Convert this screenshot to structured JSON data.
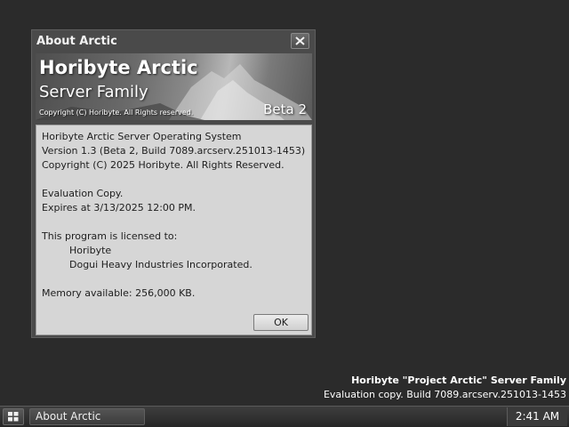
{
  "dialog": {
    "title": "About Arctic",
    "close_icon": "close-icon",
    "banner": {
      "product": "Horibyte Arctic",
      "subtitle": "Server Family",
      "copyright": "Copyright (C) Horibyte. All Rights reserved.",
      "beta": "Beta 2"
    },
    "lines": {
      "os_name": "Horibyte Arctic Server Operating System",
      "version": "Version 1.3 (Beta 2, Build 7089.arcserv.251013-1453)",
      "copyright": "Copyright (C) 2025 Horibyte. All Rights Reserved.",
      "eval": "Evaluation Copy.",
      "expires": "Expires at 3/13/2025 12:00 PM.",
      "licensed_to": "This program is licensed to:",
      "licensee_1": "Horibyte",
      "licensee_2": "Dogui Heavy Industries Incorporated.",
      "memory": "Memory available: 256,000 KB."
    },
    "ok_label": "OK"
  },
  "watermark": {
    "line1": "Horibyte \"Project Arctic\" Server Family",
    "line2": "Evaluation copy. Build 7089.arcserv.251013-1453"
  },
  "taskbar": {
    "start_icon": "windows-grid-icon",
    "task_label": "About Arctic",
    "clock": "2:41 AM"
  }
}
